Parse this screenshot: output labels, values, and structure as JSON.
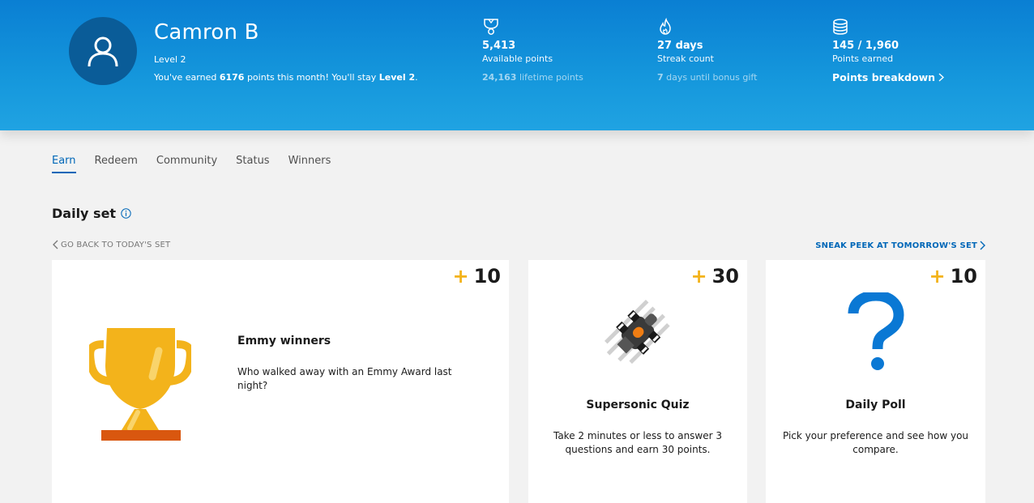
{
  "profile": {
    "name": "Camron B",
    "level": "Level 2",
    "earned_prefix": "You've earned ",
    "earned_points": "6176",
    "earned_middle": " points this month! You'll stay ",
    "earned_level": "Level 2",
    "earned_suffix": "."
  },
  "stats": {
    "available": {
      "icon": "trophy-icon",
      "value": "5,413",
      "label": "Available points",
      "sub_value": "24,163",
      "sub_label": " lifetime points"
    },
    "streak": {
      "icon": "flame-icon",
      "value": "27 days",
      "label": "Streak count",
      "sub_value": "7",
      "sub_label": " days until bonus gift"
    },
    "earned": {
      "icon": "coins-icon",
      "value": "145 / 1,960",
      "label": "Points earned",
      "link": "Points breakdown"
    }
  },
  "tabs": [
    "Earn",
    "Redeem",
    "Community",
    "Status",
    "Winners"
  ],
  "active_tab": "Earn",
  "daily_set": {
    "title": "Daily set",
    "back_label": "GO BACK TO TODAY'S SET",
    "forward_label": "SNEAK PEEK AT TOMORROW'S SET"
  },
  "cards": [
    {
      "points": "10",
      "plus": "+",
      "title": "Emmy winners",
      "description": "Who walked away with an Emmy Award last night?",
      "icon": "trophy-illustration"
    },
    {
      "points": "30",
      "plus": "+",
      "title": "Supersonic Quiz",
      "description": "Take 2 minutes or less to answer 3 questions and earn 30 points.",
      "icon": "race-car-illustration"
    },
    {
      "points": "10",
      "plus": "+",
      "title": "Daily Poll",
      "description": "Pick your preference and see how you compare.",
      "icon": "question-mark-illustration"
    }
  ],
  "colors": {
    "header": "#1597dc",
    "accent": "#0067b8",
    "points_plus": "#f3b31b",
    "trophy": "#f3b31b",
    "poll": "#0a78d4"
  }
}
